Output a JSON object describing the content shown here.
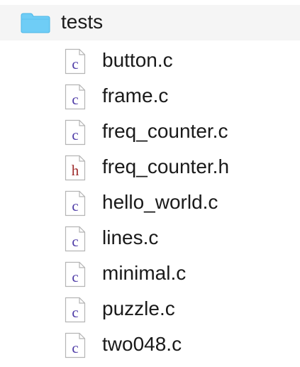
{
  "folder": {
    "name": "tests",
    "icon": "folder-icon",
    "icon_color": "#5ec8f5"
  },
  "files": [
    {
      "name": "button.c",
      "icon": "c-file-icon",
      "letter": "c",
      "letter_color": "#4d3aa6"
    },
    {
      "name": "frame.c",
      "icon": "c-file-icon",
      "letter": "c",
      "letter_color": "#4d3aa6"
    },
    {
      "name": "freq_counter.c",
      "icon": "c-file-icon",
      "letter": "c",
      "letter_color": "#4d3aa6"
    },
    {
      "name": "freq_counter.h",
      "icon": "h-file-icon",
      "letter": "h",
      "letter_color": "#9e2b2b"
    },
    {
      "name": "hello_world.c",
      "icon": "c-file-icon",
      "letter": "c",
      "letter_color": "#4d3aa6"
    },
    {
      "name": "lines.c",
      "icon": "c-file-icon",
      "letter": "c",
      "letter_color": "#4d3aa6"
    },
    {
      "name": "minimal.c",
      "icon": "c-file-icon",
      "letter": "c",
      "letter_color": "#4d3aa6"
    },
    {
      "name": "puzzle.c",
      "icon": "c-file-icon",
      "letter": "c",
      "letter_color": "#4d3aa6"
    },
    {
      "name": "two048.c",
      "icon": "c-file-icon",
      "letter": "c",
      "letter_color": "#4d3aa6"
    }
  ]
}
